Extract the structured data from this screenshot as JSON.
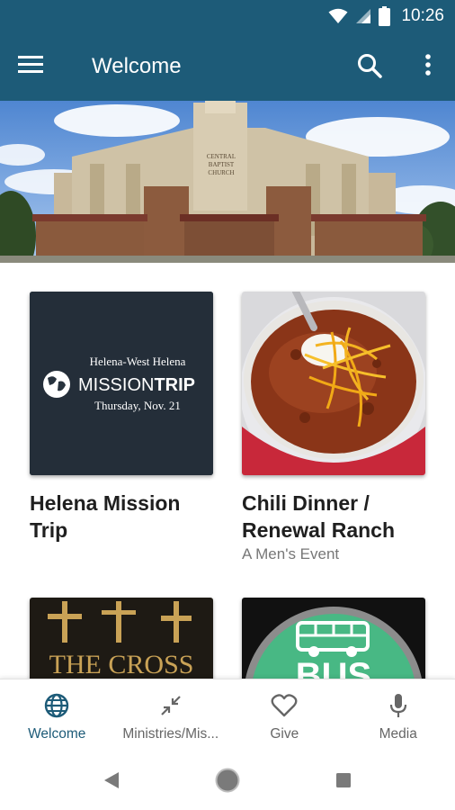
{
  "status_bar": {
    "time": "10:26",
    "icons": [
      "wifi-icon",
      "signal-icon",
      "battery-icon"
    ]
  },
  "app_bar": {
    "title": "Welcome",
    "icons": [
      "menu-icon",
      "search-icon",
      "more-vert-icon"
    ]
  },
  "banner": {
    "sign_text": [
      "CENTRAL",
      "BAPTIST",
      "CHURCH"
    ]
  },
  "cards": [
    {
      "title": "Helena Mission Trip",
      "subtitle": "",
      "image_text": {
        "line1": "Helena-West Helena",
        "line2a": "MISSION",
        "line2b": "TRIP",
        "line3": "Thursday, Nov. 21"
      }
    },
    {
      "title": "Chili Dinner / Renewal Ranch",
      "subtitle": "A Men's Event"
    },
    {
      "title": "",
      "subtitle": "",
      "image_text": {
        "line1": "THE CROSS"
      }
    },
    {
      "title": "",
      "subtitle": "",
      "image_text": {
        "line1": "BUS"
      }
    }
  ],
  "bottom_nav": [
    {
      "label": "Welcome",
      "icon": "globe-icon",
      "active": true
    },
    {
      "label": "Ministries/Mis...",
      "icon": "collapse-arrows-icon",
      "active": false
    },
    {
      "label": "Give",
      "icon": "heart-icon",
      "active": false
    },
    {
      "label": "Media",
      "icon": "microphone-icon",
      "active": false
    }
  ],
  "colors": {
    "primary": "#1d5b78",
    "nav_inactive": "#666666",
    "text_dark": "#1f1f1f",
    "text_secondary": "#777777"
  }
}
